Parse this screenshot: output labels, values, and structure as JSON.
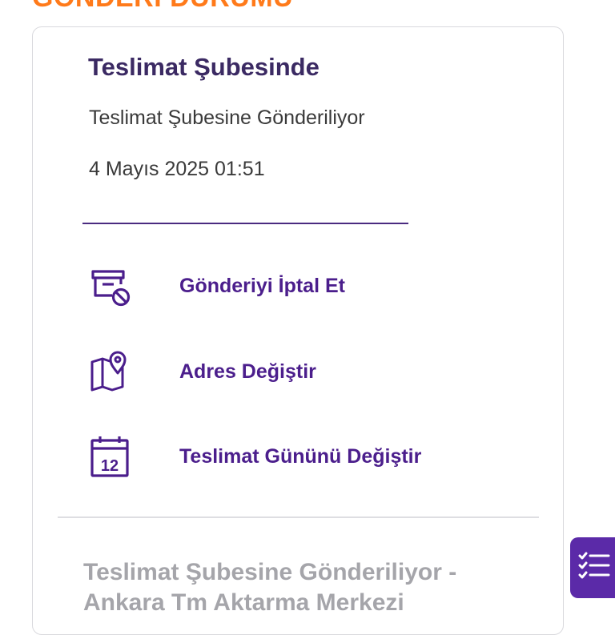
{
  "section_heading": "GÖNDERİ DURUMU",
  "status": {
    "title": "Teslimat Şubesinde",
    "subtitle": "Teslimat Şubesine Gönderiliyor",
    "date": "4 Mayıs 2025 01:51"
  },
  "actions": [
    {
      "label": "Gönderiyi İptal Et",
      "icon": "cancel-shipment-icon"
    },
    {
      "label": "Adres Değiştir",
      "icon": "map-pin-icon"
    },
    {
      "label": "Teslimat Gününü Değiştir",
      "icon": "calendar-icon",
      "icon_text": "12"
    }
  ],
  "history": {
    "first_entry": "Teslimat Şubesine Gönderiliyor - Ankara Tm Aktarma Merkezi"
  },
  "fab": {
    "icon": "checklist-icon"
  },
  "colors": {
    "accent_orange": "#ff7a1a",
    "primary_purple": "#4b1e8c",
    "title_purple": "#3b2a63",
    "fab_purple": "#5b2aa8",
    "muted_gray": "#a5a5aa"
  }
}
